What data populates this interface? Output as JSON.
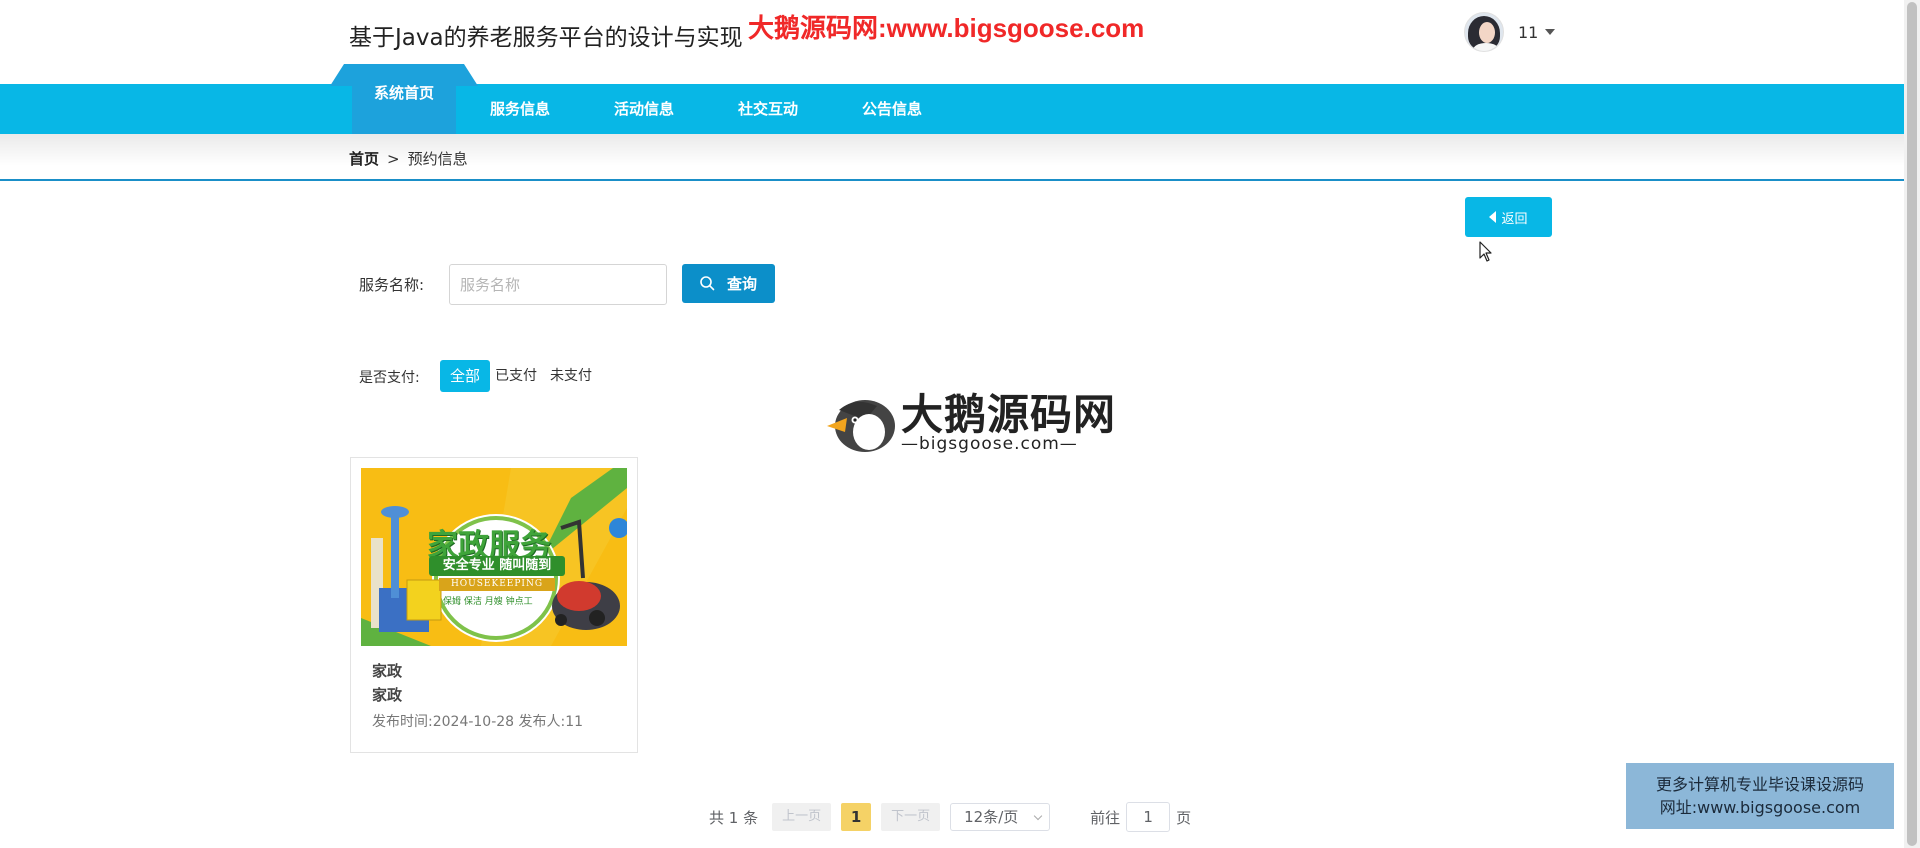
{
  "header": {
    "site_title": "基于Java的养老服务平台的设计与实现",
    "watermark_top": "大鹅源码网:www.bigsgoose.com",
    "username": "11"
  },
  "nav": {
    "items": [
      {
        "label": "系统首页",
        "active": true
      },
      {
        "label": "服务信息",
        "active": false
      },
      {
        "label": "活动信息",
        "active": false
      },
      {
        "label": "社交互动",
        "active": false
      },
      {
        "label": "公告信息",
        "active": false
      }
    ]
  },
  "breadcrumb": {
    "home": "首页",
    "separator": ">",
    "current": "预约信息"
  },
  "back_button": {
    "label": "返回"
  },
  "search": {
    "label": "服务名称:",
    "placeholder": "服务名称",
    "button_label": "查询"
  },
  "pay_filter": {
    "label": "是否支付:",
    "options": [
      {
        "label": "全部",
        "active": true
      },
      {
        "label": "已支付",
        "active": false
      },
      {
        "label": "未支付",
        "active": false
      }
    ]
  },
  "logo_watermark": {
    "cn": "大鹅源码网",
    "en": "—bigsgoose.com—"
  },
  "cards": [
    {
      "title": "家政",
      "subtitle": "家政",
      "meta": "发布时间:2024-10-28 发布人:11",
      "image": {
        "headline": "家政服务",
        "tagline": "安全专业 随叫随到",
        "en": "HOUSEKEEPING",
        "services": "保姆 保洁 月嫂 钟点工"
      }
    }
  ],
  "pagination": {
    "total": "共 1 条",
    "prev_label": "上一页",
    "current_page": "1",
    "next_label": "下一页",
    "page_size": "12条/页",
    "jump_prefix": "前往",
    "jump_value": "1",
    "jump_suffix": "页"
  },
  "promo": {
    "line1": "更多计算机专业毕设课设源码",
    "line2": "网址:www.bigsgoose.com"
  },
  "colors": {
    "nav_bg": "#08b7e6",
    "nav_active": "#1da2dc",
    "search_button": "#0c8fc9",
    "page_active": "#f5d266",
    "watermark": "#f02828",
    "promo_bg": "#8cb7d8"
  },
  "icons": [
    "caret-down-icon",
    "back-arrow-icon",
    "search-icon",
    "mouse-cursor-icon",
    "goose-logo-icon"
  ]
}
